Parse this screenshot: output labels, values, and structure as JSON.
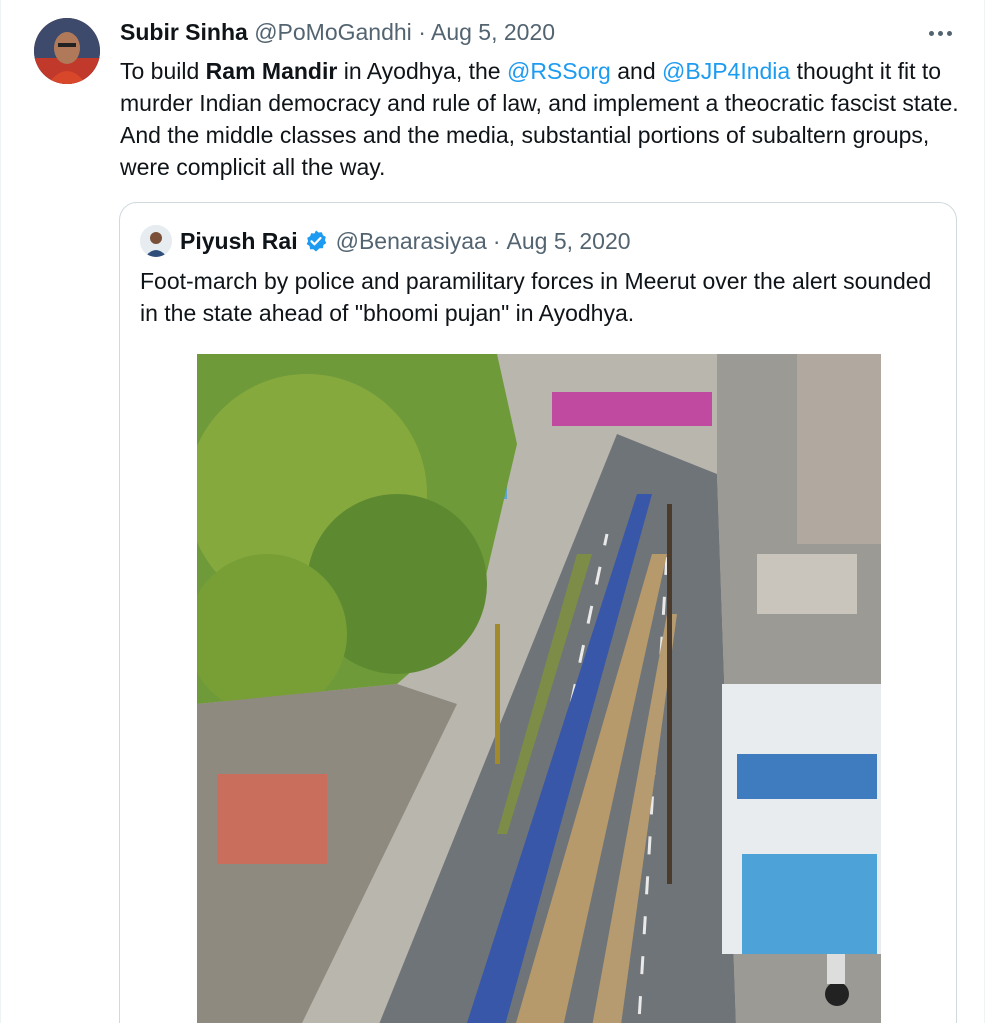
{
  "tweet": {
    "author_name": "Subir Sinha",
    "author_handle": "@PoMoGandhi",
    "separator": "·",
    "date": "Aug 5, 2020",
    "text_parts": {
      "p1": "To build ",
      "bold": "Ram Mandir",
      "p2": " in Ayodhya, the ",
      "mention1": "@RSSorg",
      "p3": " and ",
      "mention2": "@BJP4India",
      "p4": " thought it fit to murder Indian democracy and rule of law, and implement a theocratic fascist state. And the middle classes and the media, substantial portions of subaltern groups, were complicit all the way."
    }
  },
  "quoted": {
    "author_name": "Piyush Rai",
    "author_handle": "@Benarasiyaa",
    "separator": "·",
    "date": "Aug 5, 2020",
    "text": "Foot-march by police and paramilitary forces in Meerut over the alert sounded in the state ahead of \"bhoomi pujan\" in Ayodhya.",
    "verified_icon": "verified-badge-icon"
  },
  "colors": {
    "link": "#1d9bf0",
    "muted": "#536471",
    "border": "#cfd9de"
  }
}
